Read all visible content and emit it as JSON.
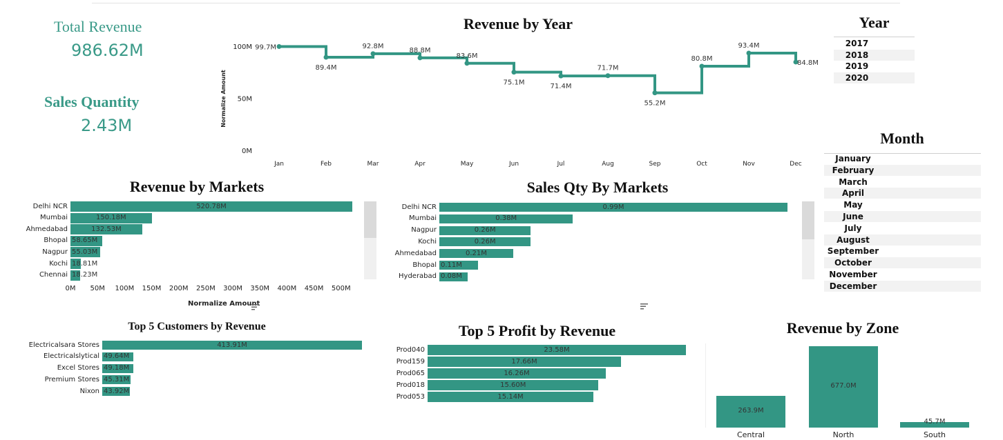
{
  "kpis": {
    "total_revenue_label": "Total Revenue",
    "total_revenue_value": "986.62M",
    "sales_qty_label": "Sales Quantity",
    "sales_qty_value": "2.43M"
  },
  "colors": {
    "accent": "#339684",
    "kpi": "#3a9a88"
  },
  "year_filter": {
    "title": "Year",
    "items": [
      "2017",
      "2018",
      "2019",
      "2020"
    ]
  },
  "month_filter": {
    "title": "Month",
    "items": [
      "January",
      "February",
      "March",
      "April",
      "May",
      "June",
      "July",
      "August",
      "September",
      "October",
      "November",
      "December"
    ]
  },
  "chart_data": [
    {
      "id": "revenue_by_year",
      "type": "line",
      "title": "Revenue by Year",
      "ylabel": "Normalize Amount",
      "xlabel": "",
      "ylim": [
        0,
        100
      ],
      "yticks": [
        "0M",
        "50M",
        "100M"
      ],
      "categories": [
        "Jan",
        "Feb",
        "Mar",
        "Apr",
        "May",
        "Jun",
        "Jul",
        "Aug",
        "Sep",
        "Oct",
        "Nov",
        "Dec"
      ],
      "values": [
        99.7,
        89.4,
        92.8,
        88.8,
        83.6,
        75.1,
        71.4,
        71.7,
        55.2,
        80.8,
        93.4,
        84.8
      ],
      "labels": [
        "99.7M",
        "89.4M",
        "92.8M",
        "88.8M",
        "83.6M",
        "75.1M",
        "71.4M",
        "71.7M",
        "55.2M",
        "80.8M",
        "93.4M",
        "84.8M"
      ],
      "step": true
    },
    {
      "id": "revenue_by_markets",
      "type": "bar",
      "orientation": "horizontal",
      "title": "Revenue by Markets",
      "xlabel": "Normalize Amount",
      "xlim": [
        0,
        520
      ],
      "xticks": [
        "0M",
        "50M",
        "100M",
        "150M",
        "200M",
        "250M",
        "300M",
        "350M",
        "400M",
        "450M",
        "500M"
      ],
      "categories": [
        "Delhi NCR",
        "Mumbai",
        "Ahmedabad",
        "Bhopal",
        "Nagpur",
        "Kochi",
        "Chennai"
      ],
      "values": [
        520.78,
        150.18,
        132.53,
        58.65,
        55.03,
        18.81,
        18.23
      ],
      "labels": [
        "520.78M",
        "150.18M",
        "132.53M",
        "58.65M",
        "55.03M",
        "18.81M",
        "18.23M"
      ]
    },
    {
      "id": "sales_qty_by_markets",
      "type": "bar",
      "orientation": "horizontal",
      "title": "Sales Qty By Markets",
      "categories": [
        "Delhi NCR",
        "Mumbai",
        "Nagpur",
        "Kochi",
        "Ahmedabad",
        "Bhopal",
        "Hyderabad"
      ],
      "values": [
        0.99,
        0.38,
        0.26,
        0.26,
        0.21,
        0.11,
        0.08
      ],
      "labels": [
        "0.99M",
        "0.38M",
        "0.26M",
        "0.26M",
        "0.21M",
        "0.11M",
        "0.08M"
      ]
    },
    {
      "id": "top5_customers",
      "type": "bar",
      "orientation": "horizontal",
      "title": "Top 5 Customers by Revenue",
      "categories": [
        "Electricalsara Stores",
        "Electricalslytical",
        "Excel Stores",
        "Premium Stores",
        "Nixon"
      ],
      "values": [
        413.91,
        49.64,
        49.18,
        45.31,
        43.92
      ],
      "labels": [
        "413.91M",
        "49.64M",
        "49.18M",
        "45.31M",
        "43.92M"
      ]
    },
    {
      "id": "top5_profit",
      "type": "bar",
      "orientation": "horizontal",
      "title": "Top 5 Profit by Revenue",
      "categories": [
        "Prod040",
        "Prod159",
        "Prod065",
        "Prod018",
        "Prod053"
      ],
      "values": [
        23.58,
        17.66,
        16.26,
        15.6,
        15.14
      ],
      "labels": [
        "23.58M",
        "17.66M",
        "16.26M",
        "15.60M",
        "15.14M"
      ]
    },
    {
      "id": "revenue_by_zone",
      "type": "bar",
      "orientation": "vertical",
      "title": "Revenue by Zone",
      "categories": [
        "Central",
        "North",
        "South"
      ],
      "values": [
        263.9,
        677.0,
        45.7
      ],
      "labels": [
        "263.9M",
        "677.0M",
        "45.7M"
      ]
    }
  ]
}
